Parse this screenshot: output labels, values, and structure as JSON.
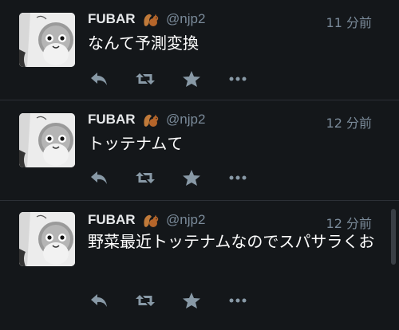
{
  "tweets": [
    {
      "display_name": "FUBAR",
      "handle": "@njp2",
      "time": "11 分前",
      "text": "なんて予測変換"
    },
    {
      "display_name": "FUBAR",
      "handle": "@njp2",
      "time": "12 分前",
      "text": "トッテナムて"
    },
    {
      "display_name": "FUBAR",
      "handle": "@njp2",
      "time": "12 分前",
      "text": "野菜最近トッテナムなのでスパサラくお"
    }
  ],
  "icons": {
    "reply": "reply-icon",
    "retweet": "retweet-icon",
    "favorite": "star-icon",
    "more": "more-icon",
    "badge": "squirrel-icon"
  },
  "colors": {
    "background": "#14171a",
    "text": "#ffffff",
    "muted": "#7a8a99",
    "icon": "#8899a6"
  }
}
